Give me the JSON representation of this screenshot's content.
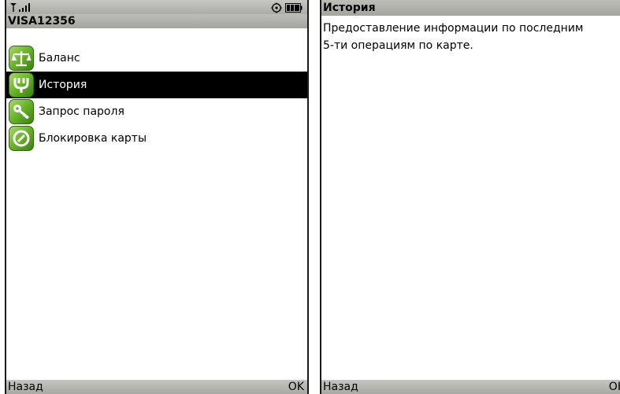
{
  "left_screen": {
    "title": "VISA12356",
    "menu": [
      {
        "label": "Баланс",
        "icon": "scales-icon",
        "selected": false
      },
      {
        "label": "История",
        "icon": "history-icon",
        "selected": true
      },
      {
        "label": "Запрос пароля",
        "icon": "key-icon",
        "selected": false
      },
      {
        "label": "Блокировка карты",
        "icon": "shield-icon",
        "selected": false
      }
    ],
    "softkeys": {
      "left": "Назад",
      "right": "OK"
    }
  },
  "right_screen": {
    "title": "История",
    "description_line1": "Предоставление информации по последним",
    "description_line2": "5-ти операциям по карте.",
    "softkeys": {
      "left": "Назад",
      "right": "OK"
    }
  },
  "colors": {
    "icon_green": "#67b227",
    "selection": "#000000",
    "bar_gray": "#b4b5b0"
  }
}
